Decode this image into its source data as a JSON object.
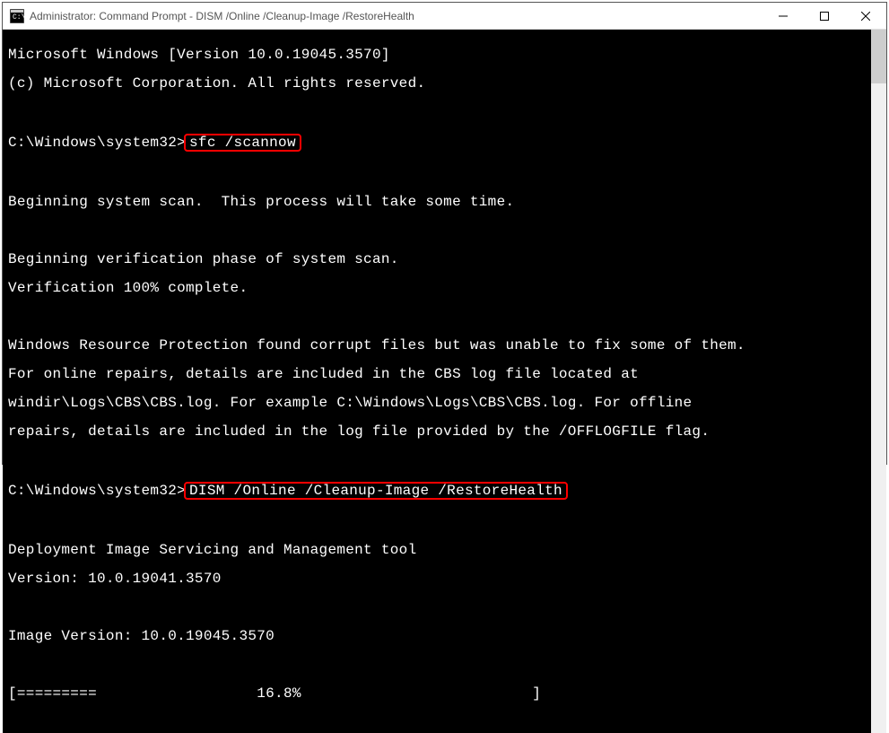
{
  "window": {
    "title": "Administrator: Command Prompt - DISM  /Online /Cleanup-Image /RestoreHealth"
  },
  "console": {
    "line1": "Microsoft Windows [Version 10.0.19045.3570]",
    "line2": "(c) Microsoft Corporation. All rights reserved.",
    "prompt1": "C:\\Windows\\system32>",
    "cmd1": "sfc /scannow",
    "line3": "Beginning system scan.  This process will take some time.",
    "line4": "Beginning verification phase of system scan.",
    "line5": "Verification 100% complete.",
    "line6": "Windows Resource Protection found corrupt files but was unable to fix some of them.",
    "line7": "For online repairs, details are included in the CBS log file located at",
    "line8": "windir\\Logs\\CBS\\CBS.log. For example C:\\Windows\\Logs\\CBS\\CBS.log. For offline",
    "line9": "repairs, details are included in the log file provided by the /OFFLOGFILE flag.",
    "prompt2": "C:\\Windows\\system32>",
    "cmd2": "DISM /Online /Cleanup-Image /RestoreHealth",
    "line10": "Deployment Image Servicing and Management tool",
    "line11": "Version: 10.0.19041.3570",
    "line12": "Image Version: 10.0.19045.3570",
    "progress": "[=========                  16.8%                          ]"
  }
}
